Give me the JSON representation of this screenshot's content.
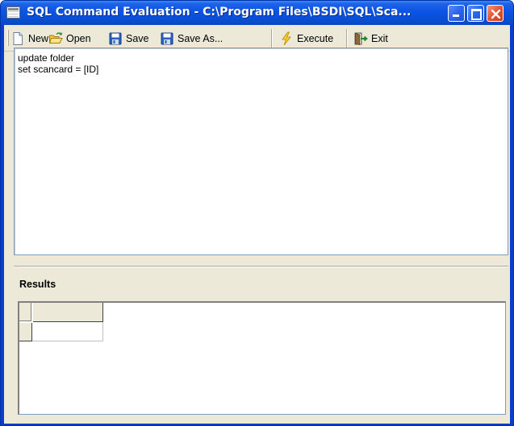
{
  "window": {
    "title": "SQL Command Evaluation - C:\\Program Files\\BSDI\\SQL\\Sca..."
  },
  "toolbar": {
    "new_label": "New",
    "open_label": "Open",
    "save_label": "Save",
    "save_as_label": "Save As...",
    "execute_label": "Execute",
    "exit_label": "Exit"
  },
  "editor": {
    "lines": [
      "update folder",
      "set scancard = [ID]"
    ]
  },
  "results": {
    "label": "Results"
  },
  "colors": {
    "titlebar": "#0a54e3",
    "face": "#ece9d8",
    "field_border": "#7f9db9"
  }
}
